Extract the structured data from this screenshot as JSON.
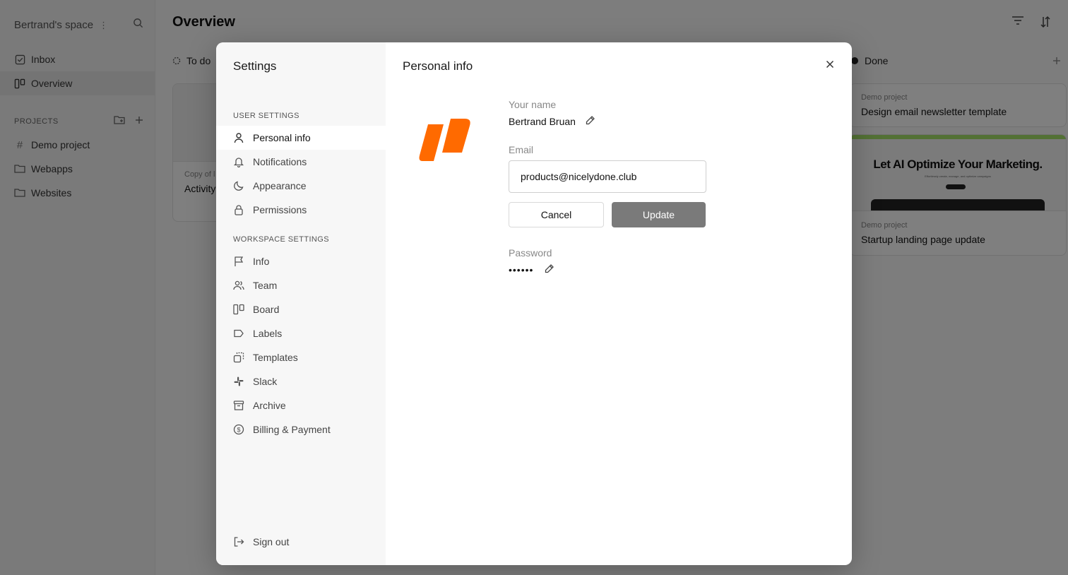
{
  "workspace": {
    "name": "Bertrand's space"
  },
  "nav": [
    {
      "label": "Inbox",
      "icon": "inbox-icon"
    },
    {
      "label": "Overview",
      "icon": "board-icon",
      "active": true
    }
  ],
  "projects": {
    "header": "PROJECTS",
    "items": [
      {
        "label": "Demo project",
        "icon": "hash-icon"
      },
      {
        "label": "Webapps",
        "icon": "folder-icon"
      },
      {
        "label": "Websites",
        "icon": "folder-icon"
      }
    ]
  },
  "main": {
    "title": "Overview",
    "columns": {
      "todo": "To do",
      "done": "Done"
    },
    "todo_card": {
      "project": "Copy of l",
      "title": "Activity"
    },
    "done_cards": [
      {
        "project": "Demo project",
        "title": "Design email newsletter template"
      },
      {
        "project": "Demo project",
        "title": "Startup landing page update",
        "promo_heading": "Let AI Optimize Your Marketing.",
        "promo_sub": "Effortlessly create, manage, and optimize campaigns"
      }
    ]
  },
  "settings": {
    "title": "Settings",
    "user_section": "USER SETTINGS",
    "user_items": [
      {
        "label": "Personal info",
        "icon": "user-icon",
        "active": true
      },
      {
        "label": "Notifications",
        "icon": "bell-icon"
      },
      {
        "label": "Appearance",
        "icon": "moon-icon"
      },
      {
        "label": "Permissions",
        "icon": "lock-icon"
      }
    ],
    "workspace_section": "WORKSPACE SETTINGS",
    "workspace_items": [
      {
        "label": "Info",
        "icon": "flag-icon"
      },
      {
        "label": "Team",
        "icon": "team-icon"
      },
      {
        "label": "Board",
        "icon": "board-icon"
      },
      {
        "label": "Labels",
        "icon": "label-icon"
      },
      {
        "label": "Templates",
        "icon": "templates-icon"
      },
      {
        "label": "Slack",
        "icon": "slack-icon"
      },
      {
        "label": "Archive",
        "icon": "archive-icon"
      },
      {
        "label": "Billing & Payment",
        "icon": "dollar-icon"
      }
    ],
    "sign_out": "Sign out"
  },
  "personal_info": {
    "title": "Personal info",
    "name_label": "Your name",
    "name_value": "Bertrand Bruan",
    "email_label": "Email",
    "email_value": "products@nicelydone.club",
    "cancel_label": "Cancel",
    "update_label": "Update",
    "password_label": "Password",
    "password_value": "••••••",
    "brand_color": "#ff6a00"
  }
}
